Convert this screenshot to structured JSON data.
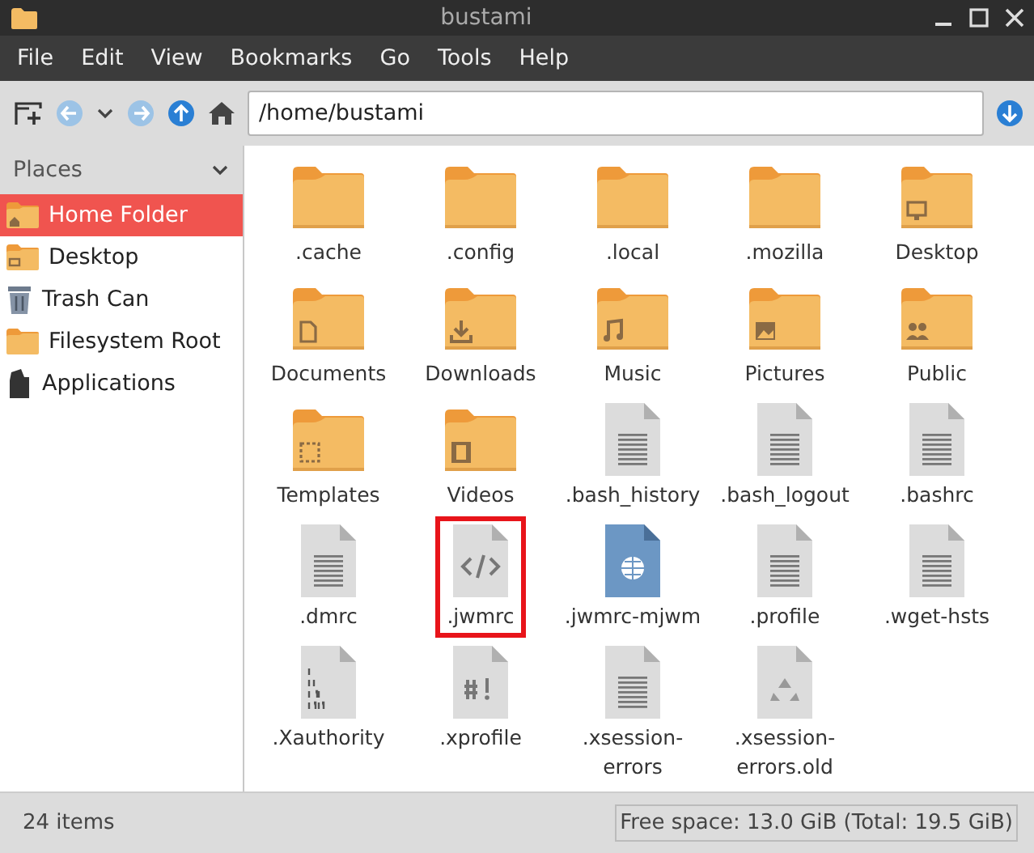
{
  "window": {
    "title": "bustami"
  },
  "menu": [
    "File",
    "Edit",
    "View",
    "Bookmarks",
    "Go",
    "Tools",
    "Help"
  ],
  "location": {
    "value": "/home/bustami"
  },
  "sidebar": {
    "title": "Places",
    "items": [
      {
        "label": "Home Folder",
        "kind": "home",
        "selected": true
      },
      {
        "label": "Desktop",
        "kind": "desk",
        "selected": false
      },
      {
        "label": "Trash Can",
        "kind": "trash",
        "selected": false
      },
      {
        "label": "Filesystem Root",
        "kind": "folder",
        "selected": false
      },
      {
        "label": "Applications",
        "kind": "apps",
        "selected": false
      }
    ]
  },
  "files": [
    {
      "name": ".cache",
      "kind": "folder",
      "highlighted": false
    },
    {
      "name": ".config",
      "kind": "folder",
      "highlighted": false
    },
    {
      "name": ".local",
      "kind": "folder",
      "highlighted": false
    },
    {
      "name": ".mozilla",
      "kind": "folder",
      "highlighted": false
    },
    {
      "name": "Desktop",
      "kind": "folder",
      "highlighted": false
    },
    {
      "name": "Documents",
      "kind": "folder",
      "highlighted": false
    },
    {
      "name": "Downloads",
      "kind": "folder",
      "highlighted": false
    },
    {
      "name": "Music",
      "kind": "folder",
      "highlighted": false
    },
    {
      "name": "Pictures",
      "kind": "folder",
      "highlighted": false
    },
    {
      "name": "Public",
      "kind": "folder",
      "highlighted": false
    },
    {
      "name": "Templates",
      "kind": "folder",
      "highlighted": false
    },
    {
      "name": "Videos",
      "kind": "folder",
      "highlighted": false
    },
    {
      "name": ".bash_history",
      "kind": "file",
      "highlighted": false
    },
    {
      "name": ".bash_logout",
      "kind": "file",
      "highlighted": false
    },
    {
      "name": ".bashrc",
      "kind": "file",
      "highlighted": false
    },
    {
      "name": ".dmrc",
      "kind": "file",
      "highlighted": false
    },
    {
      "name": ".jwmrc",
      "kind": "file",
      "highlighted": true
    },
    {
      "name": ".jwmrc-mjwm",
      "kind": "file",
      "highlighted": false
    },
    {
      "name": ".profile",
      "kind": "file",
      "highlighted": false
    },
    {
      "name": ".wget-hsts",
      "kind": "file",
      "highlighted": false
    },
    {
      "name": ".Xauthority",
      "kind": "file",
      "highlighted": false
    },
    {
      "name": ".xprofile",
      "kind": "file",
      "highlighted": false
    },
    {
      "name": ".xsession-errors",
      "kind": "file",
      "highlighted": false
    },
    {
      "name": ".xsession-errors.old",
      "kind": "file",
      "highlighted": false
    }
  ],
  "status_bar": {
    "count": "24 items",
    "free_space": "Free space: 13.0 GiB (Total: 19.5 GiB)"
  }
}
